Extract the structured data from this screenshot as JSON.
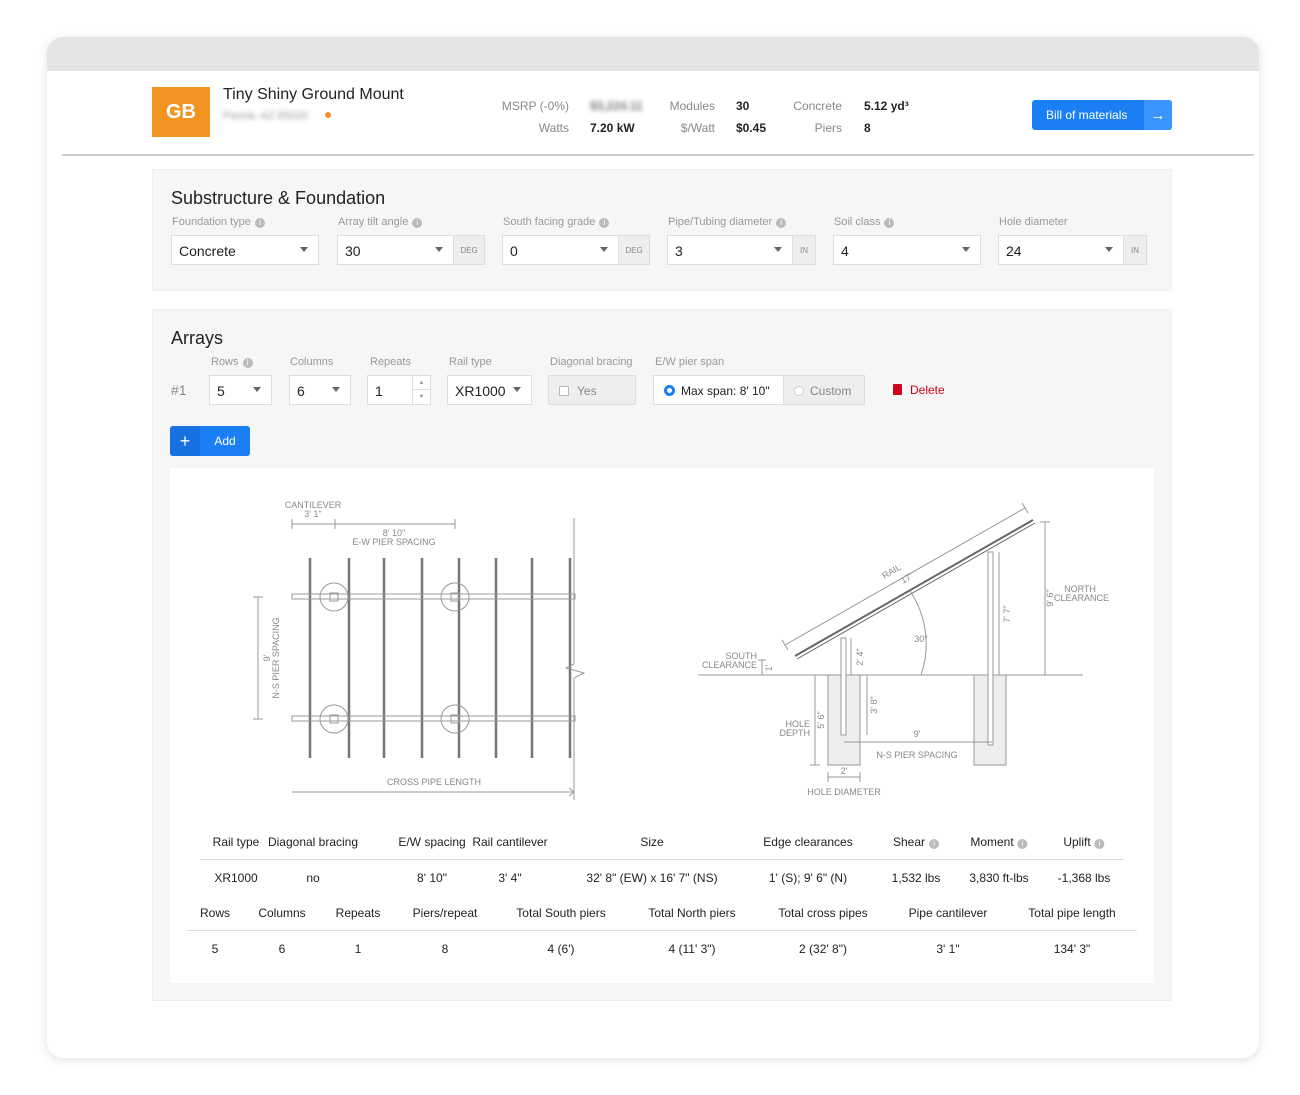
{
  "header": {
    "logo_text": "GB",
    "project_title": "Tiny Shiny Ground Mount",
    "address": "Peoria, AZ 85020",
    "location_icon": "map-pin-icon",
    "stats": [
      {
        "label": "MSRP (-0%)",
        "value": "$3,224.11",
        "blurred": true
      },
      {
        "label": "Watts",
        "value": "7.20 kW"
      },
      {
        "label": "Modules",
        "value": "30"
      },
      {
        "label": "$/Watt",
        "value": "$0.45"
      },
      {
        "label": "Concrete",
        "value": "5.12 yd³"
      },
      {
        "label": "Piers",
        "value": "8"
      }
    ],
    "bom_button": "Bill of materials",
    "bom_icon": "arrow-right-icon",
    "accent": "#1a7ff5",
    "logo_color": "#f39322"
  },
  "substructure": {
    "title": "Substructure & Foundation",
    "fields": [
      {
        "label": "Foundation type",
        "value": "Concrete",
        "info": true
      },
      {
        "label": "Array tilt angle",
        "value": "30",
        "unit": "DEG",
        "info": true
      },
      {
        "label": "South facing grade",
        "value": "0",
        "unit": "DEG",
        "info": true
      },
      {
        "label": "Pipe/Tubing diameter",
        "value": "3",
        "unit": "IN",
        "info": true
      },
      {
        "label": "Soil class",
        "value": "4",
        "info": true
      },
      {
        "label": "Hole diameter",
        "value": "24",
        "unit": "IN"
      }
    ]
  },
  "arrays": {
    "title": "Arrays",
    "labels": {
      "rows": "Rows",
      "columns": "Columns",
      "repeats": "Repeats",
      "rail_type": "Rail type",
      "diagonal_bracing": "Diagonal bracing",
      "ew_pier_span": "E/W pier span"
    },
    "row": {
      "index": "#1",
      "rows": "5",
      "columns": "6",
      "repeats": "1",
      "rail_type": "XR1000",
      "bracing_label": "Yes",
      "bracing_checked": false,
      "span_max": "Max span: 8' 10\"",
      "span_custom": "Custom",
      "span_selected": "max",
      "delete": "Delete"
    },
    "add_button": "Add",
    "delete_color": "#d0021b"
  },
  "plan_diagram": {
    "cantilever": "CANTILEVER",
    "cantilever_value": "3' 1\"",
    "ew_value": "8' 10\"",
    "ew_label": "E-W PIER SPACING",
    "ns_value": "9'",
    "ns_label": "N-S PIER SPACING",
    "cross_pipe": "CROSS PIPE LENGTH"
  },
  "side_diagram": {
    "rail": "RAIL",
    "rail_value": "17'",
    "angle": "30°",
    "north_clearance": "NORTH CLEARANCE",
    "north_value": "9' 6\"",
    "north_post": "7' 7\"",
    "south_post": "2' 4\"",
    "south_clearance": "SOUTH CLEARANCE",
    "south_value": "1'",
    "embed": "3' 8\"",
    "hole_depth": "HOLE DEPTH",
    "hole_depth_value": "5' 6\"",
    "ns_value": "9'",
    "ns_label": "N-S PIER SPACING",
    "hole_diameter": "HOLE DIAMETER",
    "hole_diameter_value": "2'"
  },
  "summary": {
    "table1": {
      "headers": [
        "Rail type",
        "Diagonal bracing",
        "E/W spacing",
        "Rail cantilever",
        "Size",
        "Edge clearances",
        "Shear",
        "Moment",
        "Uplift"
      ],
      "values": [
        "XR1000",
        "no",
        "8' 10\"",
        "3' 4\"",
        "32' 8\" (EW) x 16' 7\" (NS)",
        "1' (S); 9' 6\" (N)",
        "1,532 lbs",
        "3,830 ft-lbs",
        "-1,368 lbs"
      ]
    },
    "table2": {
      "headers": [
        "Rows",
        "Columns",
        "Repeats",
        "Piers/repeat",
        "Total South piers",
        "Total North piers",
        "Total cross pipes",
        "Pipe cantilever",
        "Total pipe length"
      ],
      "values": [
        "5",
        "6",
        "1",
        "8",
        "4 (6')",
        "4 (11' 3\")",
        "2 (32' 8\")",
        "3' 1\"",
        "134' 3\""
      ]
    }
  }
}
